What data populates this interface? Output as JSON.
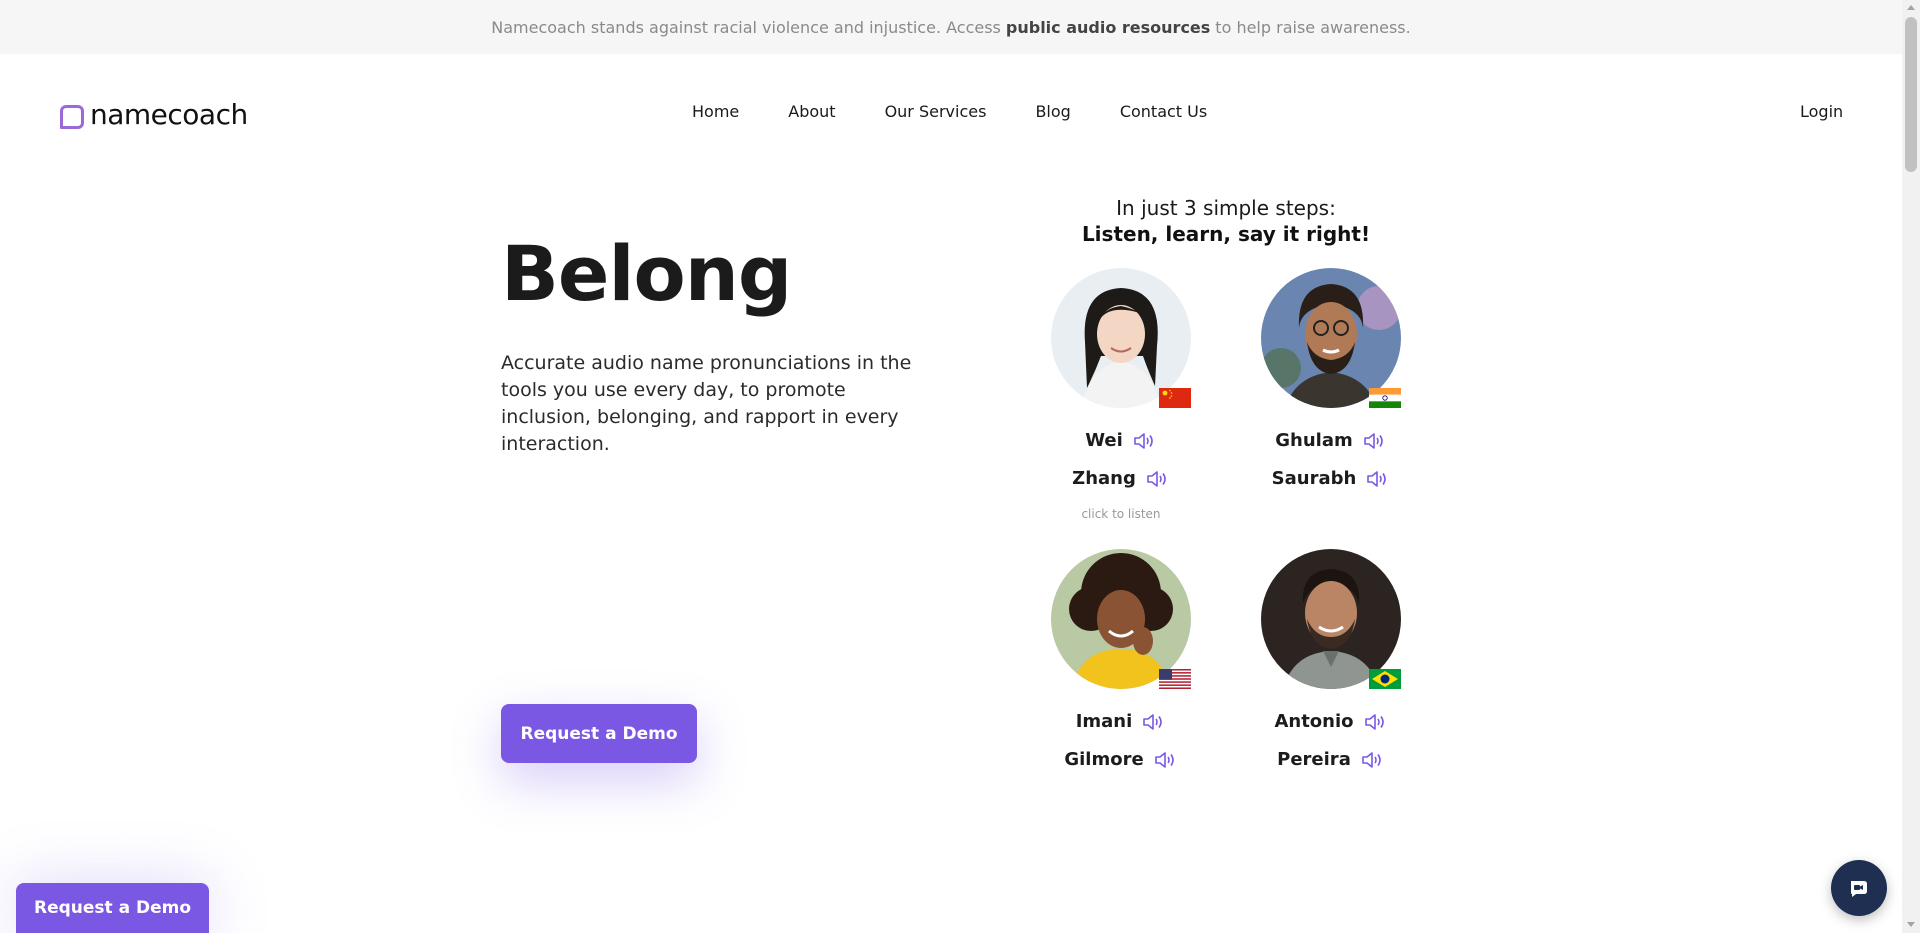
{
  "announcement": {
    "prefix": "Namecoach stands against racial violence and injustice. Access",
    "link": "public audio resources",
    "suffix": "to help raise awareness."
  },
  "logo": {
    "text": "namecoach",
    "icon": "chat-bubble-logo-icon",
    "color": "#9b6ad8"
  },
  "nav": {
    "items": [
      "Home",
      "About",
      "Our Services",
      "Blog",
      "Contact Us"
    ],
    "login": "Login"
  },
  "hero": {
    "title": "Belong",
    "description": "Accurate audio name pronunciations in the tools you use every day, to promote inclusion, belonging, and rapport in every interaction.",
    "cta": "Request a Demo"
  },
  "steps": {
    "line1": "In just 3 simple steps:",
    "line2": "Listen, learn, say it right!"
  },
  "people": [
    {
      "first": "Wei",
      "last": "Zhang",
      "flag": "china-flag",
      "hint": "click to listen"
    },
    {
      "first": "Ghulam",
      "last": "Saurabh",
      "flag": "india-flag"
    },
    {
      "first": "Imani",
      "last": "Gilmore",
      "flag": "usa-flag"
    },
    {
      "first": "Antonio",
      "last": "Pereira",
      "flag": "brazil-flag"
    }
  ],
  "sticky_cta": "Request a Demo",
  "chat_icon": "video-chat-icon",
  "colors": {
    "accent": "#7a58e3",
    "chat": "#1e2f52",
    "announce_bg": "#f6f6f6"
  }
}
